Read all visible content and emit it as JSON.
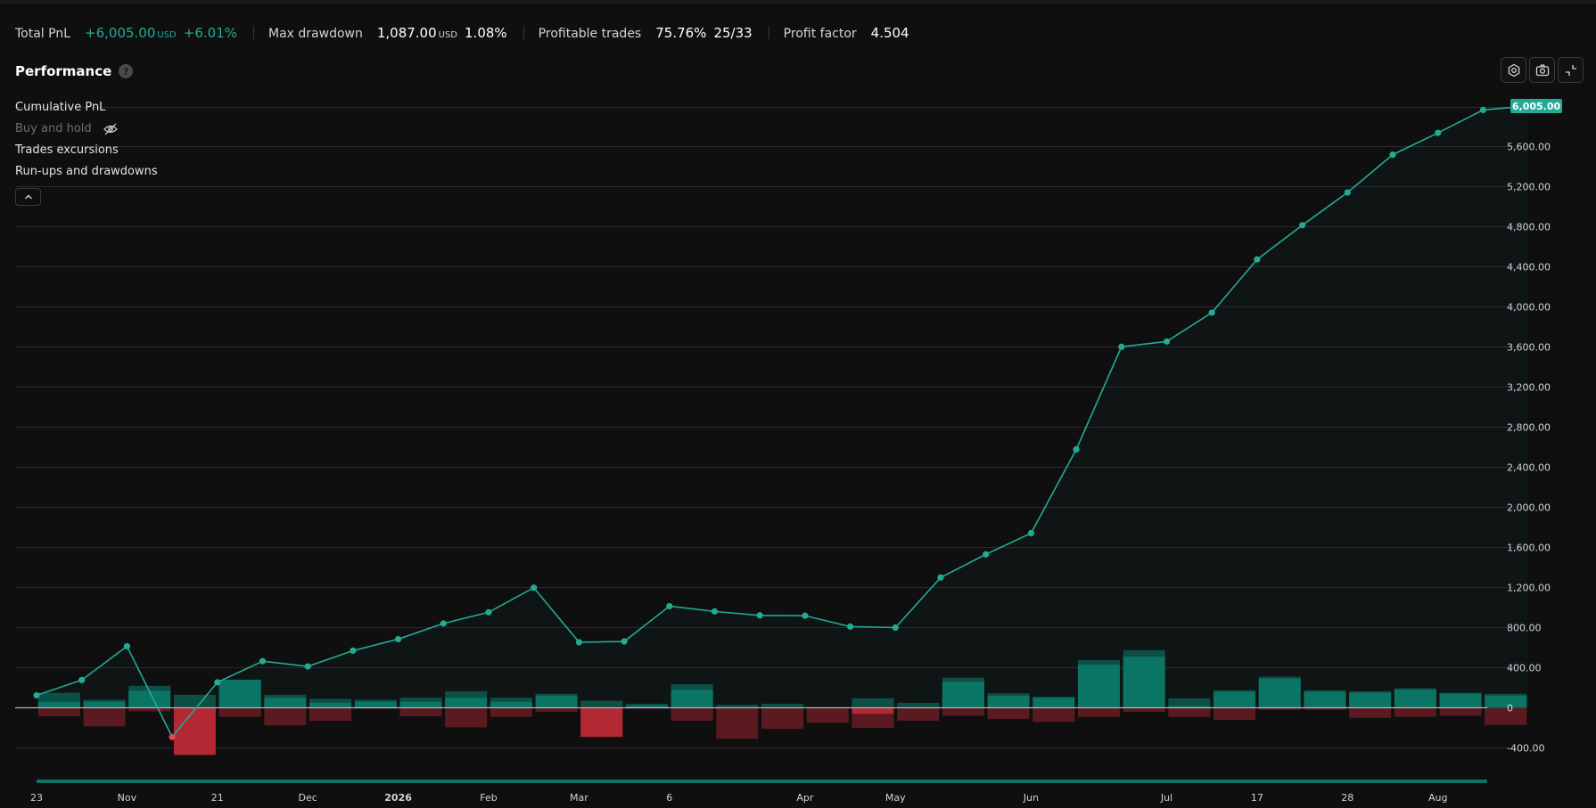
{
  "stats": {
    "total_pnl": {
      "label": "Total PnL",
      "value": "+6,005.00",
      "unit": "USD",
      "percent": "+6.01%"
    },
    "max_drawdown": {
      "label": "Max drawdown",
      "value": "1,087.00",
      "unit": "USD",
      "percent": "1.08%"
    },
    "profitable_trades": {
      "label": "Profitable trades",
      "percent": "75.76%",
      "ratio": "25/33"
    },
    "profit_factor": {
      "label": "Profit factor",
      "value": "4.504"
    }
  },
  "performance": {
    "title": "Performance",
    "help_icon": "question-icon"
  },
  "toolbar": {
    "icons": [
      "settings-icon",
      "camera-icon",
      "fullscreen-icon"
    ]
  },
  "legend": {
    "cumulative_pnl": "Cumulative PnL",
    "buy_and_hold": "Buy and hold",
    "trades_excursions": "Trades excursions",
    "runups_drawdowns": "Run-ups and drawdowns"
  },
  "colors": {
    "line": "#22ab94",
    "positive_bar": "#0b7565",
    "positive_bar_light": "#0d4f44",
    "negative_bar": "#b22833",
    "negative_bar_dark": "#5a1a20",
    "last_value_badge": "#22ab94"
  },
  "chart_data": {
    "type": "line",
    "ylim": [
      -600,
      6100
    ],
    "y_ticks": [
      -400,
      0,
      400,
      800,
      1200,
      1600,
      2000,
      2400,
      2800,
      3200,
      3600,
      4000,
      4400,
      4800,
      5200,
      5600
    ],
    "y_tick_labels": [
      "-400.00",
      "0",
      "400.00",
      "800.00",
      "1,200.00",
      "1,600.00",
      "2,000.00",
      "2,400.00",
      "2,800.00",
      "3,200.00",
      "3,600.00",
      "4,000.00",
      "4,400.00",
      "4,800.00",
      "5,200.00",
      "5,600.00"
    ],
    "last_value_label": "6,005.00",
    "x_ticks": [
      {
        "index": 0,
        "label": "23",
        "bold": false
      },
      {
        "index": 2,
        "label": "Nov",
        "bold": false
      },
      {
        "index": 4,
        "label": "21",
        "bold": false
      },
      {
        "index": 6,
        "label": "Dec",
        "bold": false
      },
      {
        "index": 8,
        "label": "2026",
        "bold": true
      },
      {
        "index": 10,
        "label": "Feb",
        "bold": false
      },
      {
        "index": 12,
        "label": "Mar",
        "bold": false
      },
      {
        "index": 14,
        "label": "6",
        "bold": false
      },
      {
        "index": 17,
        "label": "Apr",
        "bold": false
      },
      {
        "index": 19,
        "label": "May",
        "bold": false
      },
      {
        "index": 22,
        "label": "Jun",
        "bold": false
      },
      {
        "index": 25,
        "label": "Jul",
        "bold": false
      },
      {
        "index": 27,
        "label": "17",
        "bold": false
      },
      {
        "index": 29,
        "label": "28",
        "bold": false
      },
      {
        "index": 31,
        "label": "Aug",
        "bold": false
      }
    ],
    "cumulative_pnl": [
      124,
      277,
      614,
      -291,
      254,
      465,
      413,
      570,
      685,
      841,
      953,
      1198,
      654,
      662,
      1014,
      961,
      922,
      919,
      810,
      800,
      1300,
      1531,
      1742,
      2578,
      3602,
      3655,
      3943,
      4474,
      4815,
      5142,
      5519,
      5736,
      5965,
      6005
    ],
    "run_ups": [
      150,
      80,
      220,
      130,
      280,
      130,
      90,
      80,
      100,
      165,
      100,
      140,
      70,
      40,
      235,
      30,
      40,
      0,
      95,
      50,
      300,
      145,
      110,
      475,
      575,
      95,
      175,
      310,
      175,
      165,
      195,
      150,
      140
    ],
    "trade_profits": [
      60,
      60,
      170,
      0,
      280,
      100,
      50,
      60,
      60,
      100,
      60,
      120,
      0,
      20,
      180,
      0,
      0,
      0,
      0,
      0,
      260,
      120,
      100,
      430,
      510,
      20,
      160,
      290,
      160,
      150,
      180,
      140,
      120
    ],
    "drawdowns": [
      -85,
      -185,
      -35,
      -470,
      -90,
      -175,
      -130,
      -10,
      -85,
      -195,
      -90,
      -40,
      -290,
      -10,
      -130,
      -310,
      -210,
      -150,
      -200,
      -130,
      -80,
      -110,
      -140,
      -90,
      -40,
      -90,
      -120,
      -20,
      -20,
      -100,
      -90,
      -80,
      -170
    ],
    "trade_losses": [
      0,
      0,
      0,
      -470,
      0,
      0,
      0,
      0,
      0,
      0,
      0,
      0,
      -290,
      0,
      0,
      0,
      0,
      0,
      -60,
      0,
      0,
      0,
      0,
      0,
      0,
      0,
      0,
      0,
      0,
      0,
      0,
      0,
      0
    ]
  }
}
